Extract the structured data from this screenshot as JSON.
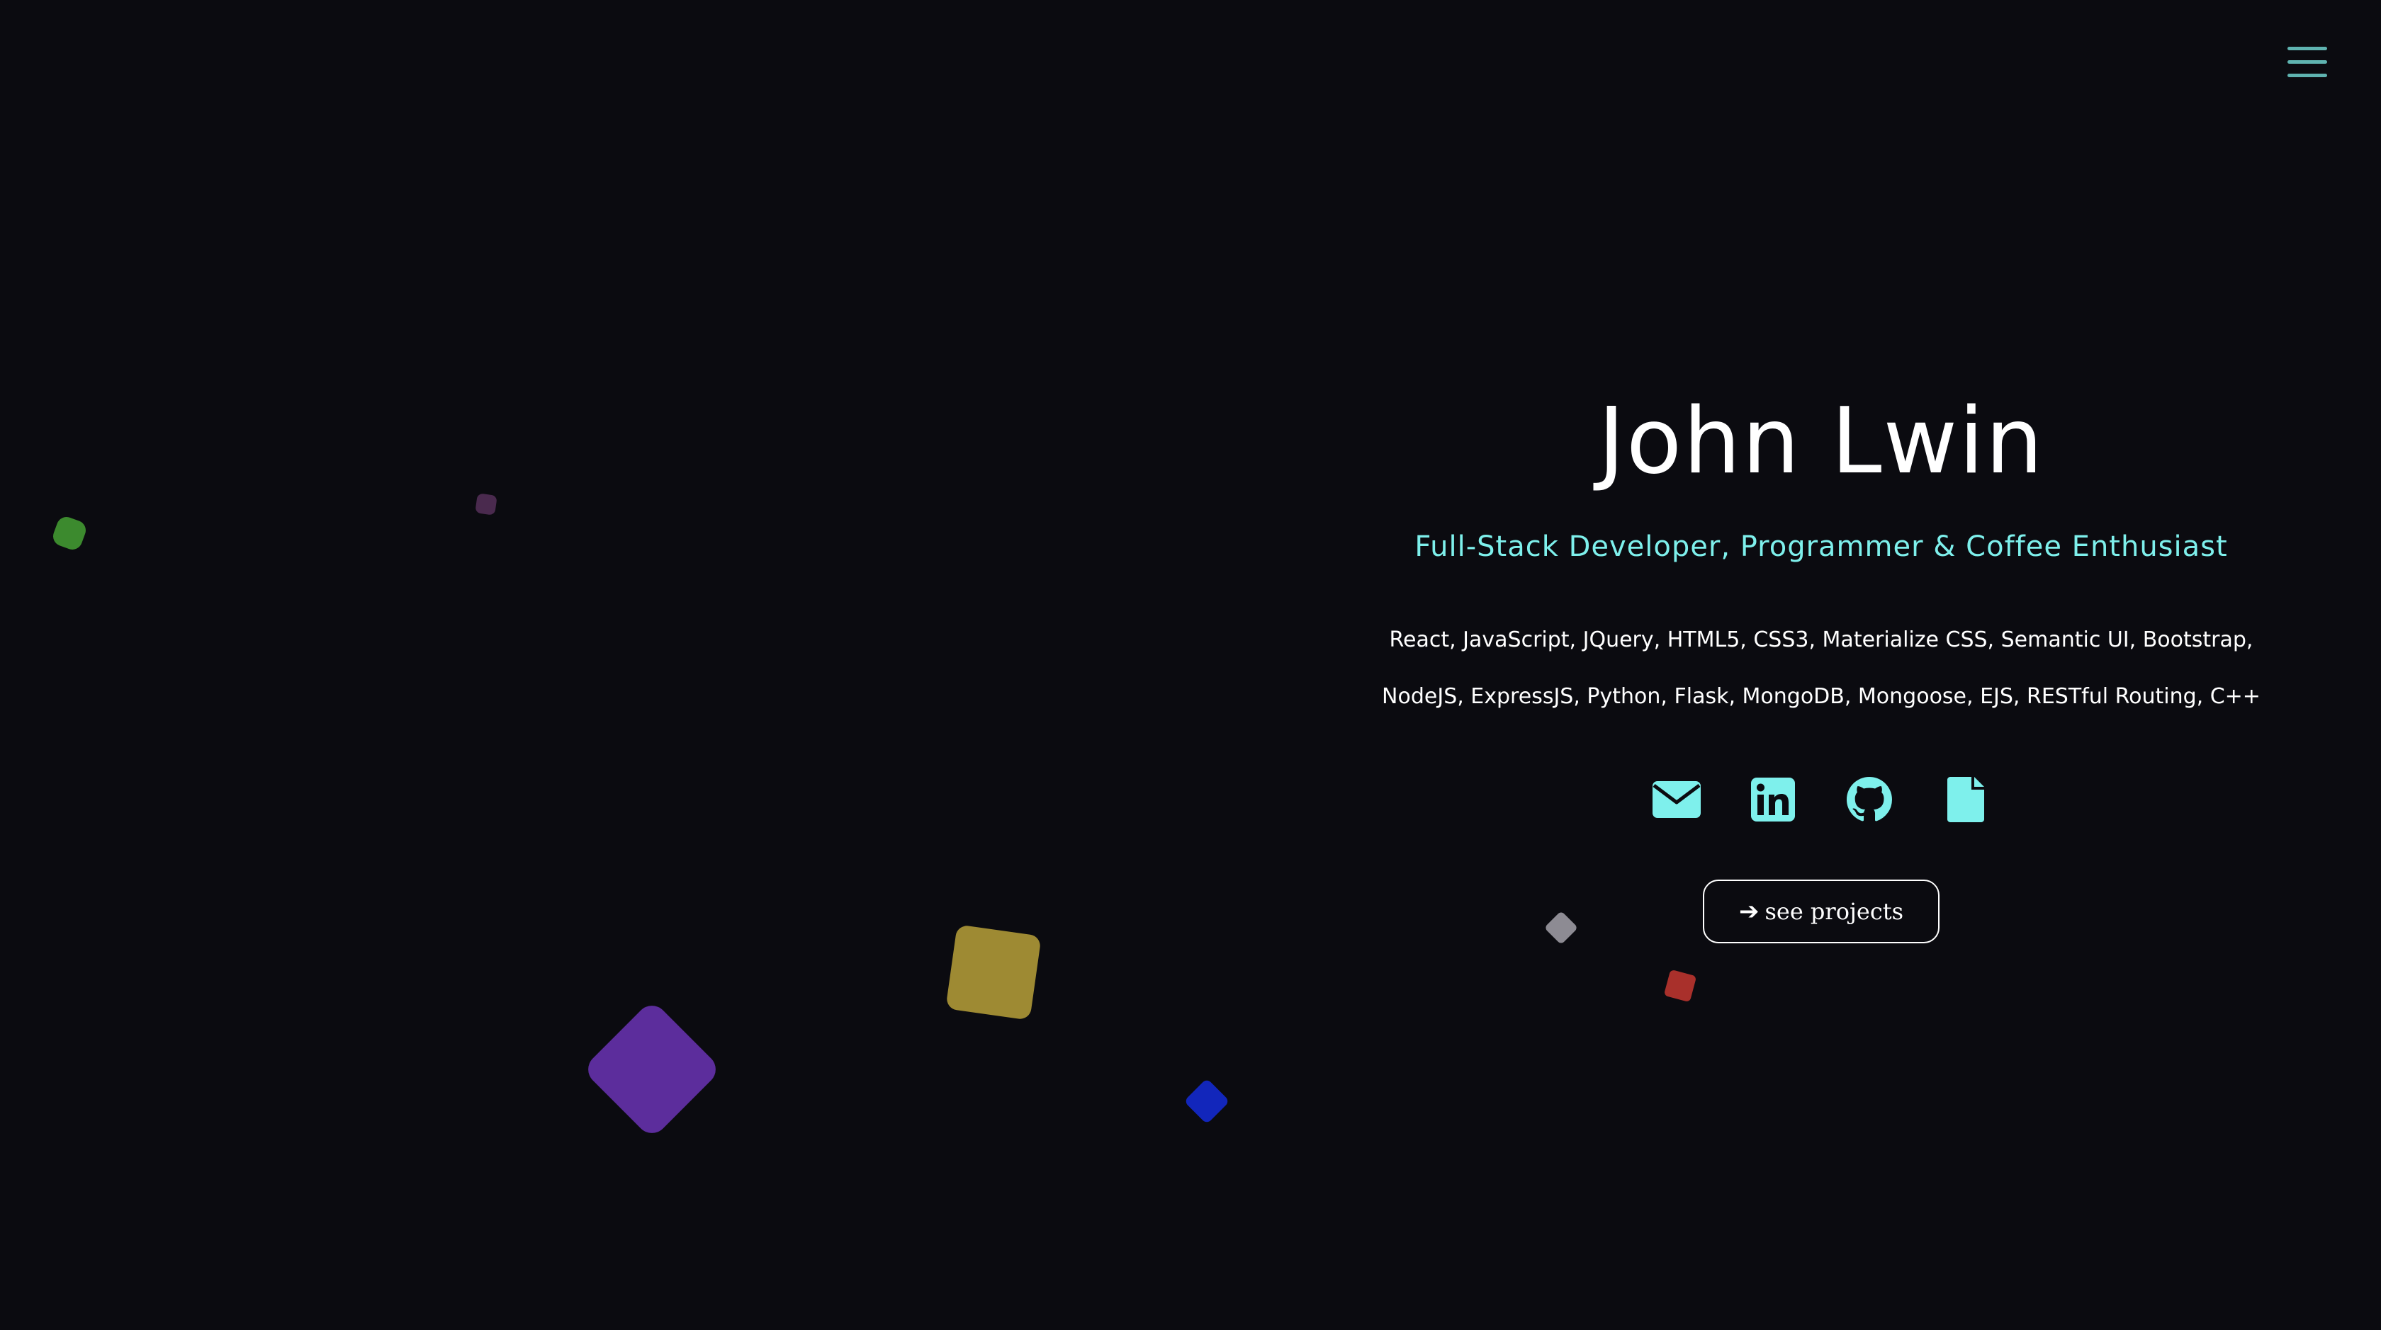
{
  "colors": {
    "background": "#0b0b10",
    "accent": "#7ef0ec",
    "menu_icon": "#5fb3b0",
    "text": "#ffffff"
  },
  "header": {
    "menu_icon": "hamburger-menu-icon"
  },
  "hero": {
    "name": "John Lwin",
    "subtitle": "Full-Stack Developer, Programmer & Coffee Enthusiast",
    "skills_line_1": "React, JavaScript, JQuery, HTML5, CSS3, Materialize CSS, Semantic UI, Bootstrap,",
    "skills_line_2": "NodeJS, ExpressJS, Python, Flask, MongoDB, Mongoose, EJS, RESTful Routing, C++"
  },
  "socials": [
    {
      "icon": "email-icon"
    },
    {
      "icon": "linkedin-icon"
    },
    {
      "icon": "github-icon"
    },
    {
      "icon": "resume-file-icon"
    }
  ],
  "cta": {
    "icon": "arrow-right-icon",
    "label": "see projects"
  },
  "decorative_shapes": [
    {
      "color": "#3c8a2e"
    },
    {
      "color": "#4a2a4e"
    },
    {
      "color": "#5c2d9c"
    },
    {
      "color": "#9e8a33"
    },
    {
      "color": "#1226bb"
    },
    {
      "color": "#8d8b93"
    },
    {
      "color": "#a9302b"
    }
  ]
}
